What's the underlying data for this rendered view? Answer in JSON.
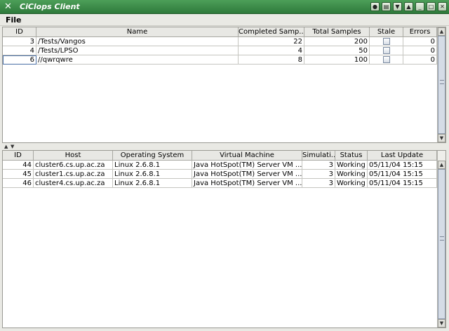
{
  "window": {
    "title": "CiClops Client",
    "app_icon": "tools-icon",
    "controls": [
      "menu-icon",
      "shade-icon",
      "down-icon",
      "up-icon",
      "minimize-icon",
      "maximize-icon",
      "close-icon"
    ]
  },
  "menu": {
    "file": "File"
  },
  "tests_table": {
    "columns": [
      "ID",
      "Name",
      "Completed Samp...",
      "Total Samples",
      "Stale",
      "Errors"
    ],
    "rows": [
      {
        "id": "3",
        "name": "/Tests/Vangos",
        "completed": "22",
        "total": "200",
        "stale": false,
        "errors": "0"
      },
      {
        "id": "4",
        "name": "/Tests/LPSO",
        "completed": "4",
        "total": "50",
        "stale": false,
        "errors": "0"
      },
      {
        "id": "6",
        "name": "//qwrqwre",
        "completed": "8",
        "total": "100",
        "stale": false,
        "errors": "0"
      }
    ]
  },
  "hosts_table": {
    "columns": [
      "ID",
      "Host",
      "Operating System",
      "Virtual Machine",
      "Simulati...",
      "Status",
      "Last Update"
    ],
    "rows": [
      {
        "id": "44",
        "host": "cluster6.cs.up.ac.za",
        "os": "Linux 2.6.8.1",
        "vm": "Java HotSpot(TM) Server VM ...",
        "sims": "3",
        "status": "Working",
        "updated": "05/11/04 15:15"
      },
      {
        "id": "45",
        "host": "cluster1.cs.up.ac.za",
        "os": "Linux 2.6.8.1",
        "vm": "Java HotSpot(TM) Server VM ...",
        "sims": "3",
        "status": "Working",
        "updated": "05/11/04 15:15"
      },
      {
        "id": "46",
        "host": "cluster4.cs.up.ac.za",
        "os": "Linux 2.6.8.1",
        "vm": "Java HotSpot(TM) Server VM ...",
        "sims": "3",
        "status": "Working",
        "updated": "05/11/04 15:15"
      }
    ]
  }
}
